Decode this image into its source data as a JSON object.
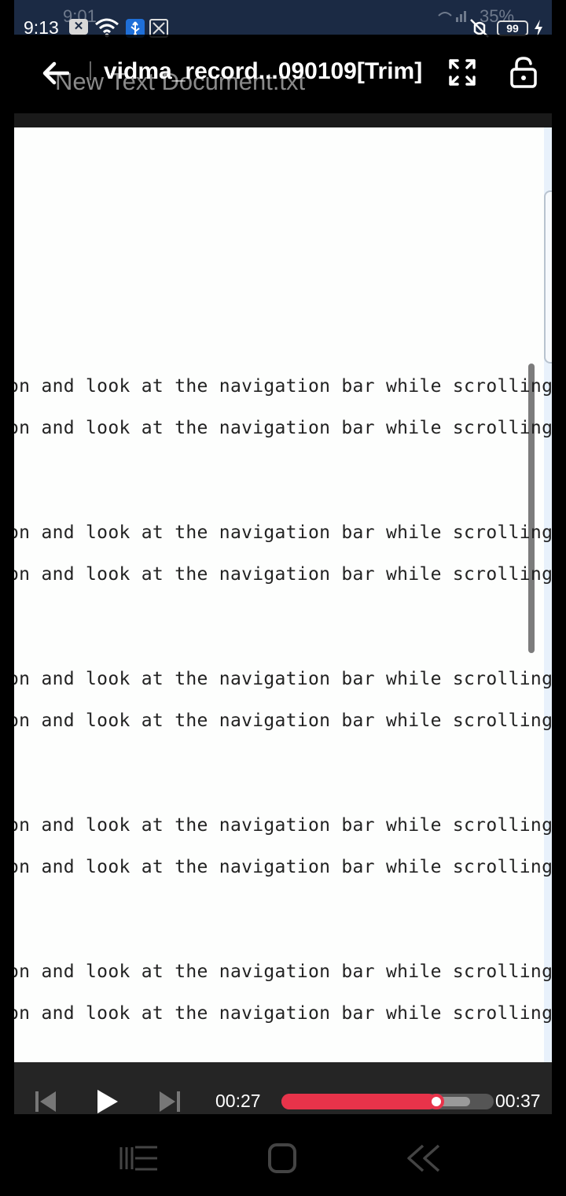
{
  "underlying_frame": {
    "time": "9:01",
    "battery": "35%",
    "document_title": "New Text Document.txt"
  },
  "status_bar": {
    "time": "9:13",
    "battery": "99",
    "icons": [
      "close-notification-icon",
      "wifi-icon",
      "usb-icon",
      "screen-recorder-icon",
      "mute-icon",
      "battery-icon",
      "charging-icon"
    ]
  },
  "top_bar": {
    "title": "vidma_record...090109[Trim]",
    "icons": [
      "back-arrow-icon",
      "fullscreen-icon",
      "unlock-icon"
    ]
  },
  "document": {
    "lines": [
      "on and look at the navigation bar while scrolling!",
      "on and look at the navigation bar while scrolling!",
      "on and look at the navigation bar while scrolling!",
      "on and look at the navigation bar while scrolling!",
      "on and look at the navigation bar while scrolling!",
      "on and look at the navigation bar while scrolling!",
      "on and look at the navigation bar while scrolling!",
      "on and look at the navigation bar while scrolling!",
      "on and look at the navigation bar while scrolling!",
      "on and look at the navigation bar while scrolling!"
    ]
  },
  "player": {
    "current_time": "00:27",
    "total_time": "00:37",
    "progress_fraction": 0.73,
    "accent_color": "#e8334a"
  },
  "nav_bar": {
    "icons": [
      "recent-apps-icon",
      "home-icon",
      "back-icon"
    ]
  }
}
